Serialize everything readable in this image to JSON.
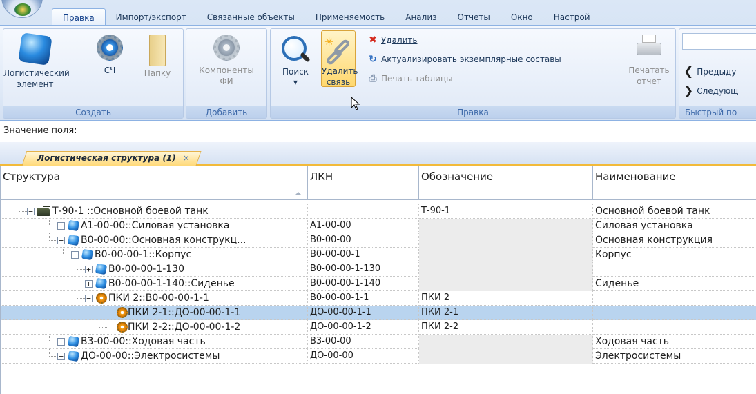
{
  "ribbon": {
    "tabs": [
      {
        "label": "Правка",
        "active": true
      },
      {
        "label": "Импорт/экспорт"
      },
      {
        "label": "Связанные объекты"
      },
      {
        "label": "Применяемость"
      },
      {
        "label": "Анализ"
      },
      {
        "label": "Отчеты"
      },
      {
        "label": "Окно"
      },
      {
        "label": "Настрой"
      }
    ],
    "groups": {
      "create": {
        "label": "Создать",
        "logical_element_l1": "Логистический",
        "logical_element_l2": "элемент",
        "sch": "СЧ",
        "folder": "Папку"
      },
      "add": {
        "label": "Добавить",
        "components_l1": "Компоненты",
        "components_l2": "ФИ"
      },
      "edit": {
        "label": "Правка",
        "search": "Поиск",
        "delete_link_l1": "Удалить",
        "delete_link_l2": "связь",
        "delete": "Удалить",
        "update_instances": "Актуализировать экземплярные составы",
        "print_table": "Печать таблицы",
        "print_report_l1": "Печатать",
        "print_report_l2": "отчет"
      },
      "quick": {
        "label": "Быстрый по",
        "prev": "Предыду",
        "next": "Следующ"
      }
    }
  },
  "field_value_label": "Значение поля:",
  "doc_tab": {
    "label": "Логистическая структура (1)",
    "close": "×"
  },
  "grid": {
    "headers": {
      "structure": "Структура",
      "lkn": "ЛКН",
      "code": "Обозначение",
      "name": "Наименование"
    },
    "rows": [
      {
        "text": "Т-90-1 ::Основной боевой танк",
        "lkn": "",
        "code": "Т-90-1",
        "name": "Основной боевой танк",
        "expander": "−",
        "icon": "tank-icon"
      },
      {
        "text": "А1-00-00::Силовая установка",
        "lkn": "А1-00-00",
        "code": "",
        "name": "Силовая установка",
        "expander": "+",
        "icon": "cube-icon"
      },
      {
        "text": "В0-00-00::Основная конструкц...",
        "lkn": "В0-00-00",
        "code": "",
        "name": "Основная конструкция",
        "expander": "−",
        "icon": "cube-icon"
      },
      {
        "text": "В0-00-00-1::Корпус",
        "lkn": "В0-00-00-1",
        "code": "",
        "name": "Корпус",
        "expander": "−",
        "icon": "cube-icon"
      },
      {
        "text": "В0-00-00-1-130",
        "lkn": "В0-00-00-1-130",
        "code": "",
        "name": "",
        "expander": "+",
        "icon": "cube-icon"
      },
      {
        "text": "В0-00-00-1-140::Сиденье",
        "lkn": "В0-00-00-1-140",
        "code": "",
        "name": "Сиденье",
        "expander": "+",
        "icon": "cube-icon"
      },
      {
        "text": "ПКИ 2::В0-00-00-1-1",
        "lkn": "В0-00-00-1-1",
        "code": "ПКИ 2",
        "name": "",
        "expander": "−",
        "icon": "gear-icon"
      },
      {
        "text": "ПКИ 2-1::ДО-00-00-1-1",
        "lkn": "ДО-00-00-1-1",
        "code": "ПКИ 2-1",
        "name": "",
        "expander": "",
        "icon": "gear-icon",
        "selected": true
      },
      {
        "text": "ПКИ 2-2::ДО-00-00-1-2",
        "lkn": "ДО-00-00-1-2",
        "code": "ПКИ 2-2",
        "name": "",
        "expander": "",
        "icon": "gear-icon"
      },
      {
        "text": "В3-00-00::Ходовая часть",
        "lkn": "В3-00-00",
        "code": "",
        "name": "Ходовая часть",
        "expander": "+",
        "icon": "cube-icon"
      },
      {
        "text": "ДО-00-00::Электросистемы",
        "lkn": "ДО-00-00",
        "code": "",
        "name": "Электросистемы",
        "expander": "+",
        "icon": "cube-icon"
      }
    ]
  }
}
